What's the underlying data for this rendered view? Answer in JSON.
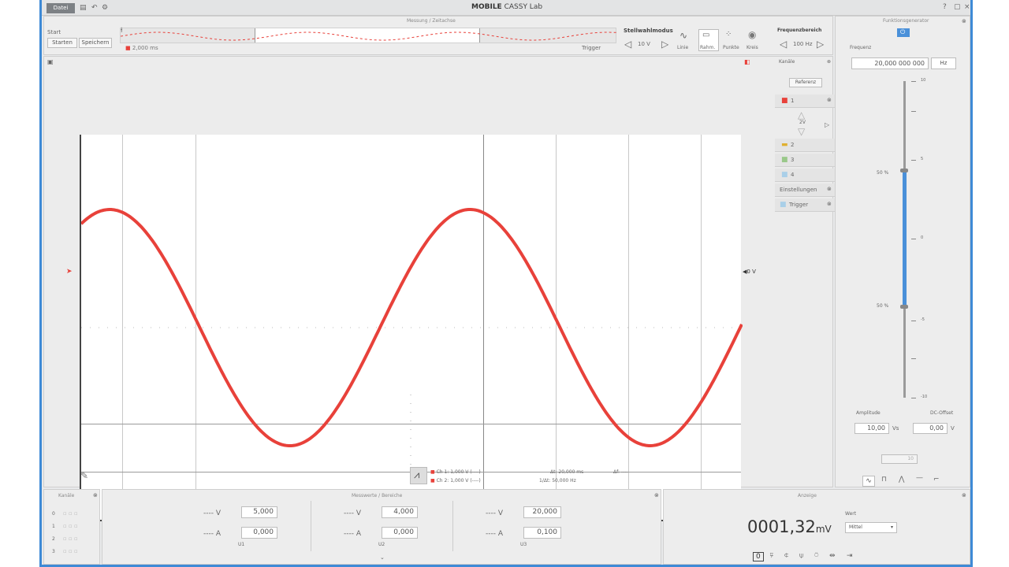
{
  "titlebar": {
    "file_button": "Datei",
    "title_brand": "MOBILE",
    "title_rest": "CASSY Lab",
    "window_controls": [
      "?",
      "▢",
      "×"
    ]
  },
  "toolbar": {
    "timeline_title": "Messung / Zeitachse",
    "start_label": "Start",
    "start_button": "Starten",
    "settings_button": "Speichern",
    "timeline_value": "2,000 ms",
    "trigger_label": "Trigger",
    "stellwahl_title": "Stellwahlmodus",
    "stellwahl_value": "10 V",
    "mode_labels": [
      "Linie",
      "Rahm.",
      "Punkte",
      "Kreis"
    ],
    "frequency_title": "Frequenzbereich",
    "frequency_value": "100 Hz"
  },
  "plot": {
    "channel_arrow_label": "",
    "right_marker_label": "0 V"
  },
  "side_panel": {
    "title": "Kanäle",
    "reference_button": "Referenz",
    "channels": [
      "1",
      "2",
      "3",
      "4"
    ],
    "settings_label": "Einstellungen",
    "trigger_label": "Trigger"
  },
  "generator": {
    "title": "Funktionsgenerator",
    "freq_label": "Frequenz",
    "frequency_value": "20,000 000 000",
    "frequency_unit": "Hz",
    "scale_top": "10",
    "scale_mid_upper": "5",
    "scale_zero": "0",
    "scale_mid_lower": "-5",
    "scale_bottom": "-10",
    "level_upper_label": "50 %",
    "level_lower_label": "50 %",
    "amplitude_label": "Amplitude",
    "offset_label": "DC-Offset",
    "amplitude_value": "10,00",
    "amplitude_unit": "Vs",
    "offset_value": "0,00",
    "offset_unit": "V",
    "stepper_value": "10",
    "waveform_buttons": [
      "∿",
      "⊓",
      "⋀",
      "—",
      "⌐"
    ]
  },
  "cursor_readout": {
    "line1": "Ch 1: 1,000 V (----)",
    "line2": "Ch 2: 1,000 V (----)",
    "line3": "Δt: 20,000 ms",
    "line4": "1/Δt: 50,000 Hz",
    "line5": "Δf: ----"
  },
  "bottom_left": {
    "title": "Kanäle",
    "rows": [
      "0",
      "1",
      "2",
      "3"
    ]
  },
  "measure_panel": {
    "title": "Messwerte / Bereiche",
    "groups": [
      {
        "v_label": "---- V",
        "v_value": "5,000",
        "a_label": "---- A",
        "a_value": "0,000",
        "footer": "U1"
      },
      {
        "v_label": "---- V",
        "v_value": "4,000",
        "a_label": "---- A",
        "a_value": "0,000",
        "footer": "U2"
      },
      {
        "v_label": "---- V",
        "v_value": "20,000",
        "a_label": "---- A",
        "a_value": "0,100",
        "footer": "U3"
      }
    ]
  },
  "big_readout": {
    "title": "Anzeige",
    "value": "0001,32",
    "unit": "mV",
    "mode_label": "Wert",
    "select_value": "Mittel"
  },
  "colors": {
    "accent": "#3e8ad6",
    "signal": "#e8413a",
    "slider": "#4a90d9"
  }
}
